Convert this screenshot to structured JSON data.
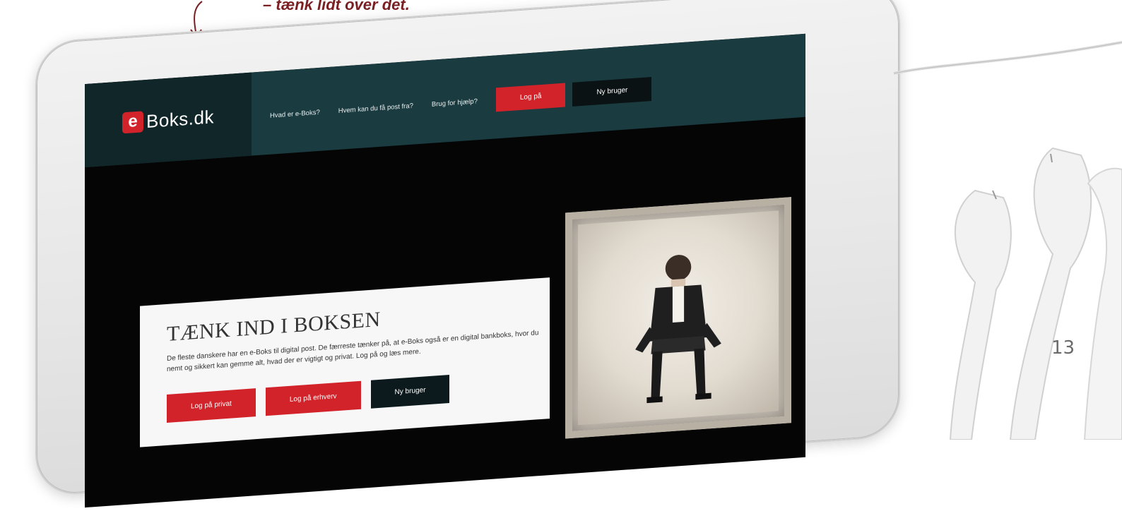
{
  "caption": "– tænk lidt over det.",
  "page_number": "13",
  "site": {
    "logo_letter": "e",
    "logo_text": "Boks.dk",
    "nav": {
      "links": [
        "Hvad er e-Boks?",
        "Hvem kan du få post fra?",
        "Brug for hjælp?"
      ],
      "login_label": "Log på",
      "new_user_label": "Ny bruger"
    },
    "hero": {
      "title": "TÆNK IND I BOKSEN",
      "text": "De fleste danskere har en e-Boks til digital post. De færreste tænker på, at e-Boks også er en digital bankboks, hvor du nemt og sikkert kan gemme alt, hvad der er vigtigt og privat. Log på og læs mere.",
      "buttons": [
        "Log på privat",
        "Log på erhverv",
        "Ny bruger"
      ]
    }
  },
  "colors": {
    "accent_red": "#d2232a",
    "header_teal": "#1a3b40",
    "caption_red": "#7a1f22"
  }
}
